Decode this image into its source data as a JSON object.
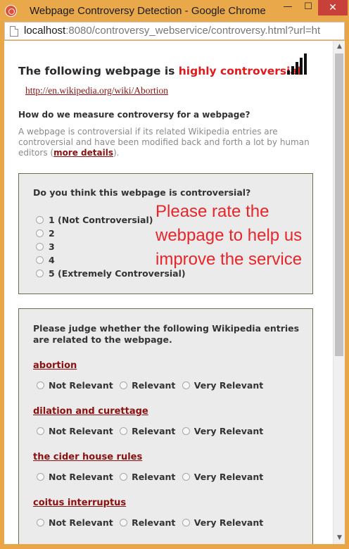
{
  "window": {
    "title": "Webpage Controversy Detection - Google Chrome",
    "minimize": "—",
    "maximize": "☐",
    "close": "✕"
  },
  "address": {
    "host": "localhost",
    "rest": ":8080/controversy_webservice/controversy.html?url=ht"
  },
  "page": {
    "headline_prefix": "The following webpage is ",
    "headline_hot": "highly controversial",
    "headline_hot_color": "#e0191c",
    "signal_level": 5,
    "url_link": "http://en.wikipedia.org/wiki/Abortion",
    "measure_question": "How do we measure controversy for a webpage?",
    "measure_text": "A webpage is controversial if its related Wikipedia entries are controversial and have been modified back and forth a lot by human editors (",
    "more_details": "more details",
    "measure_text_end": ")."
  },
  "rating_box": {
    "question": "Do you think this webpage is controversial?",
    "options": [
      "1 (Not Controversial)",
      "2",
      "3",
      "4",
      "5 (Extremely Controversial)"
    ]
  },
  "overlay_text": "Please rate the webpage to help us improve the service",
  "relevance_box": {
    "question": "Please judge whether the following Wikipedia entries are related to the webpage.",
    "choices": [
      "Not Relevant",
      "Relevant",
      "Very Relevant"
    ],
    "entries": [
      "abortion",
      "dilation and curettage",
      "the cider house rules",
      "coitus interruptus"
    ]
  }
}
